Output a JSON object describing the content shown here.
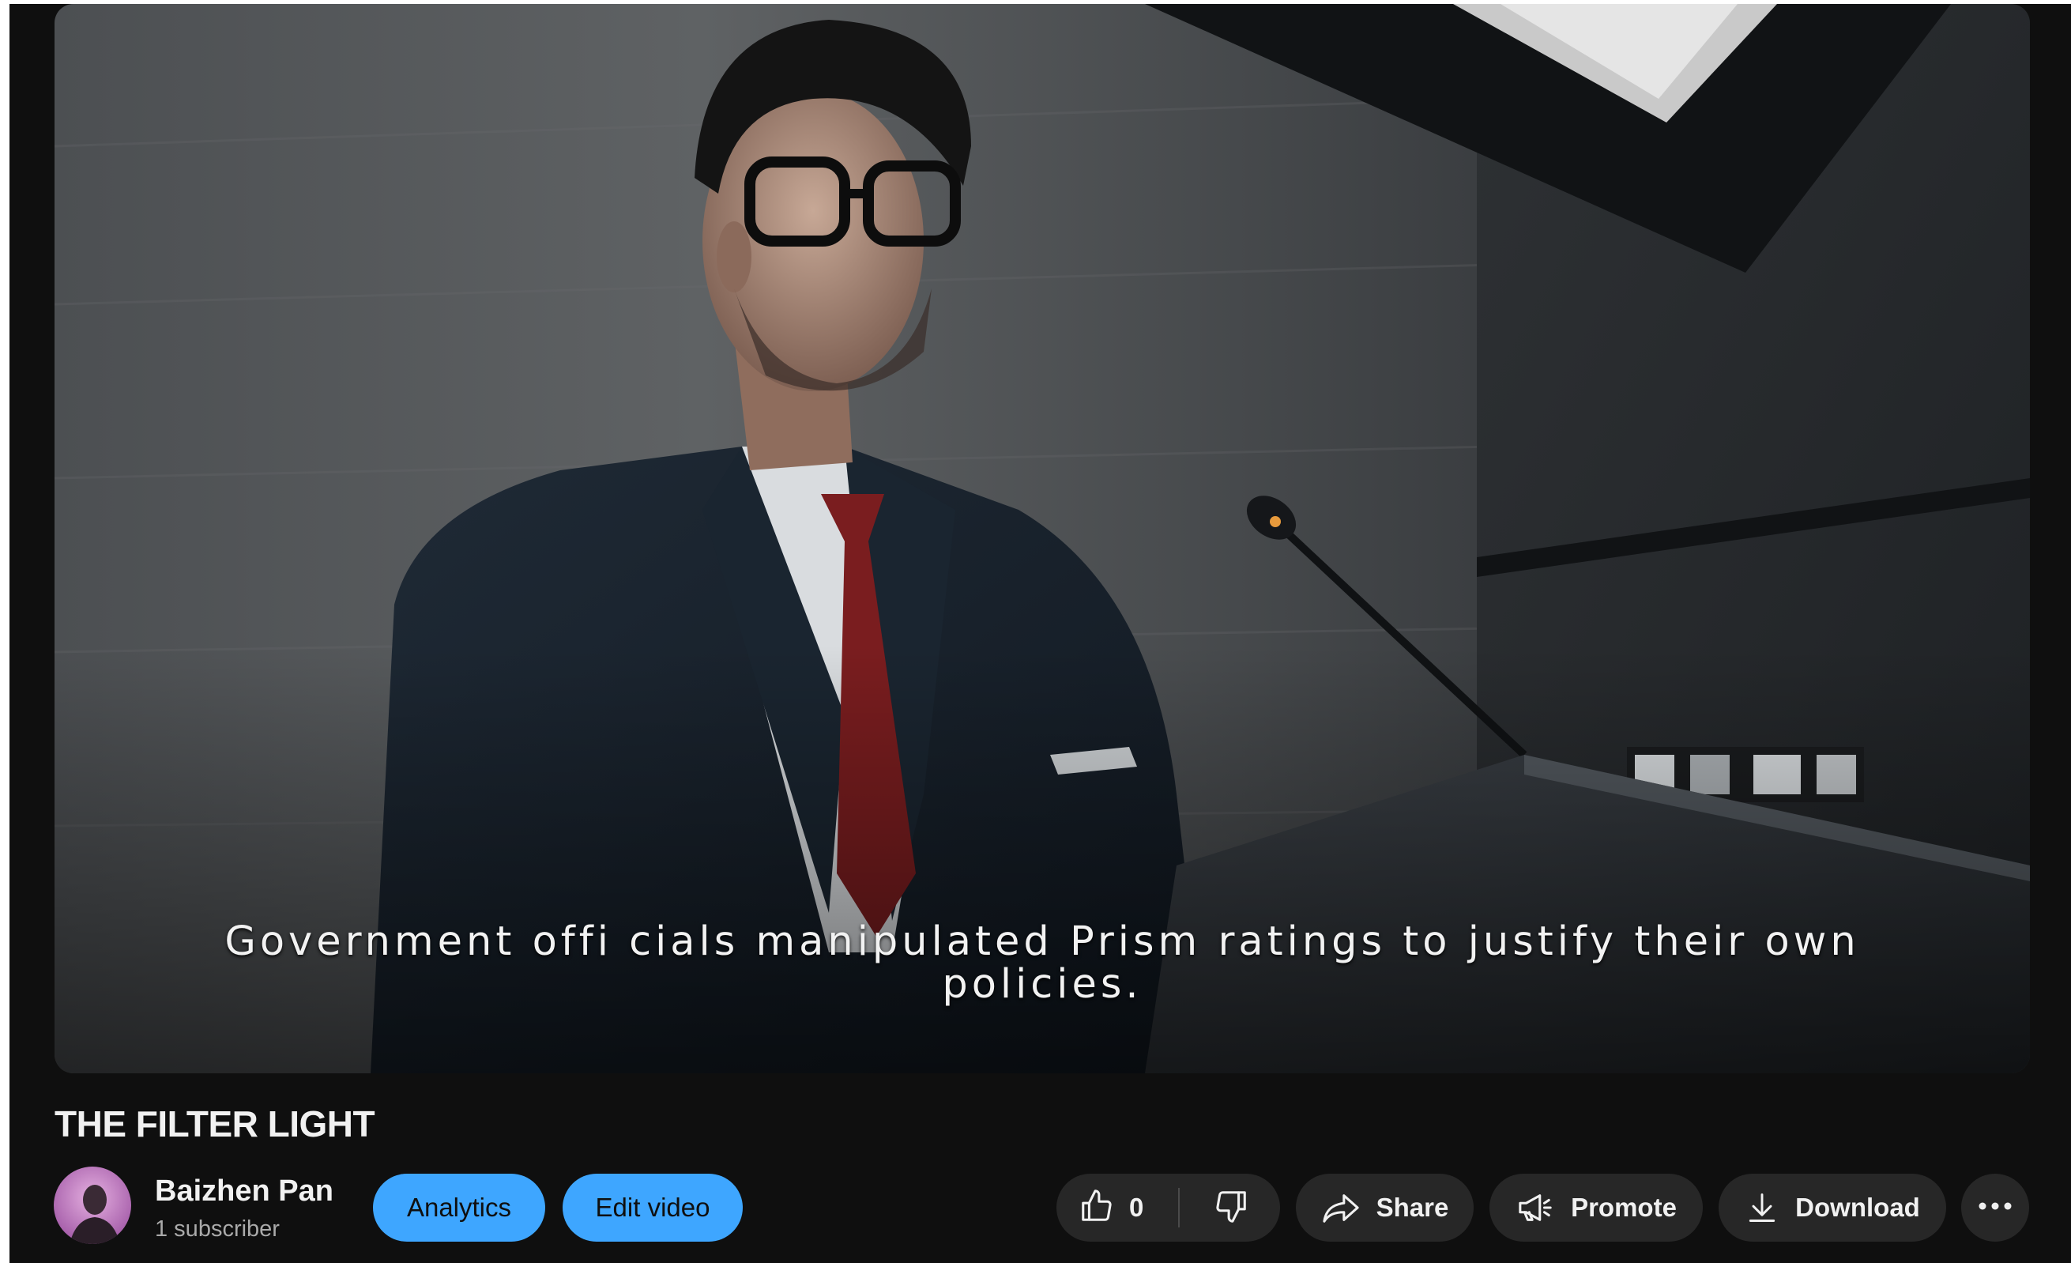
{
  "video": {
    "caption_lines": [
      "Government offi cials manipulated Prism ratings to justify their own",
      "policies."
    ],
    "title": "THE FILTER LIGHT"
  },
  "channel": {
    "name": "Baizhen Pan",
    "subscribers": "1 subscriber",
    "avatar_icon": "channel-avatar"
  },
  "owner_actions": {
    "analytics_label": "Analytics",
    "edit_label": "Edit video"
  },
  "actions": {
    "like_count": "0",
    "like_icon": "thumbs-up-icon",
    "dislike_icon": "thumbs-down-icon",
    "share_label": "Share",
    "share_icon": "share-arrow-icon",
    "promote_label": "Promote",
    "promote_icon": "megaphone-icon",
    "download_label": "Download",
    "download_icon": "download-icon",
    "more_icon": "more-horizontal-icon"
  },
  "colors": {
    "background": "#0f0f0f",
    "button_dark": "#272727",
    "accent_blue": "#3ea6ff",
    "text_primary": "#f1f1f1",
    "text_secondary": "#aaaaaa"
  }
}
